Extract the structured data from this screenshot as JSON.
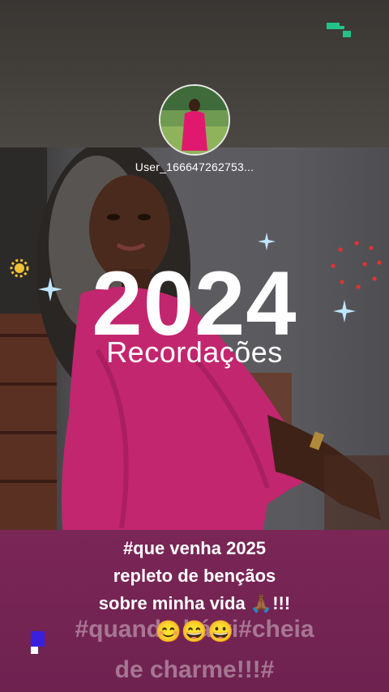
{
  "profile": {
    "username": "User_166647262753..."
  },
  "story": {
    "year": "2024",
    "subtitle": "Recordações"
  },
  "caption": {
    "line1": "#que venha 2025",
    "line2": "repleto de bençãos",
    "line3": "sobre minha vida 🙏🏾!!!",
    "line4": "😊😄😀"
  },
  "overlay_text": {
    "line1": "#quando há vi#cheia",
    "line2": "de charme!!!#"
  },
  "icons": [
    "signal-icon",
    "sparkle-icon",
    "sun-sticker-icon",
    "dots-ring-icon"
  ],
  "colors": {
    "caption_bg": "#7a2656",
    "dress": "#c2266e",
    "signal": "#22c38a",
    "corner_square": "#3a1fe0"
  }
}
